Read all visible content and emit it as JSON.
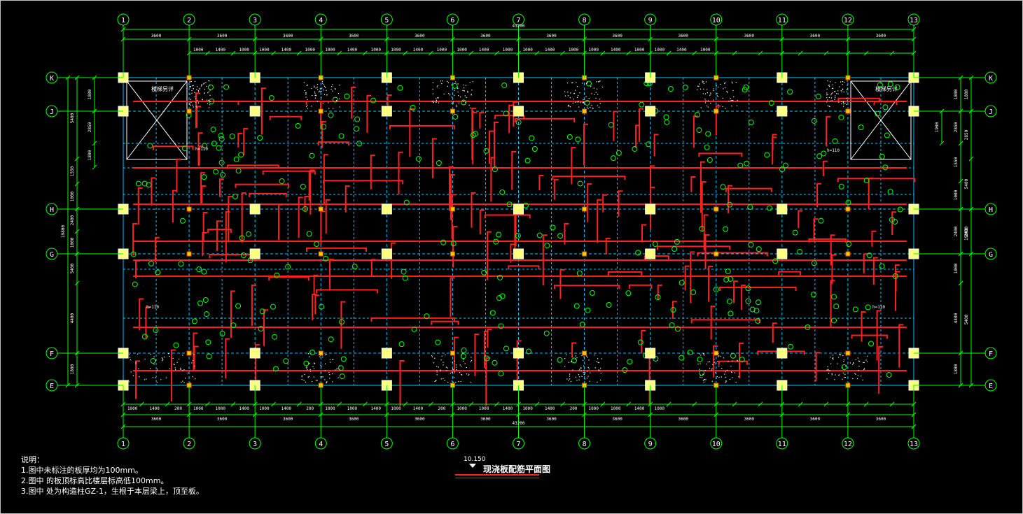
{
  "drawing": {
    "title": "现浇板配筋平面图",
    "elevation": "10.150",
    "axes_x": [
      "1",
      "2",
      "3",
      "4",
      "5",
      "6",
      "7",
      "8",
      "9",
      "10",
      "11",
      "12",
      "13"
    ],
    "axes_y": [
      "K",
      "J",
      "H",
      "G",
      "F",
      "E"
    ],
    "total_length": "43200",
    "bay_spacing": "3600",
    "bay_spacings": [
      "3600",
      "3600",
      "3600",
      "3600",
      "3600",
      "3600",
      "3600",
      "3600",
      "3600",
      "3600",
      "3600",
      "3600"
    ],
    "sub_dims_top": [
      "1000",
      "1400",
      "1000",
      "1000",
      "1400",
      "1000",
      "1000",
      "1400",
      "1000",
      "1000",
      "1400",
      "1000",
      "1000",
      "1400",
      "1000",
      "1000",
      "1400",
      "1000",
      "1000",
      "1400",
      "1000",
      "1000",
      "1400",
      "1000"
    ],
    "sub_dims_bottom": [
      "1000",
      "1400",
      "200",
      "1000",
      "1000",
      "1400",
      "1000",
      "1400",
      "200",
      "1000",
      "1000",
      "1400",
      "1000",
      "1400",
      "200",
      "1000",
      "1000",
      "1400",
      "1000",
      "1400",
      "200",
      "1000",
      "1000",
      "1400",
      "1000"
    ],
    "left_dims_outer": [
      "5400",
      "1550",
      "1000",
      "2400",
      "1000",
      "5400",
      "4400",
      "1800"
    ],
    "left_dims_inner": [
      "1800",
      "2850",
      "1800"
    ],
    "left_total": "19800",
    "right_dims": [
      "1800",
      "2850",
      "1900",
      "5400",
      "1550",
      "1000",
      "2400",
      "19800",
      "1000",
      "4400",
      "1800",
      "5400",
      "1800"
    ],
    "stair_label": "楼梯另详",
    "slab_thickness_note": "h=110",
    "colors": {
      "axis_lines": "#00ff00",
      "grid_beams": "#00c8ff",
      "rebar": "#ff2020",
      "columns": "#ffff80",
      "text": "#ffffff",
      "frame": "#c0c0c0"
    }
  },
  "notes": {
    "heading": "说明：",
    "line1": "1.图中未标注的板厚均为100mm。",
    "line2": "2.图中     的板顶标高比楼层标高低100mm。",
    "line3": "3.图中     处为构造柱GZ-1，生根于本层梁上，顶至板。"
  }
}
